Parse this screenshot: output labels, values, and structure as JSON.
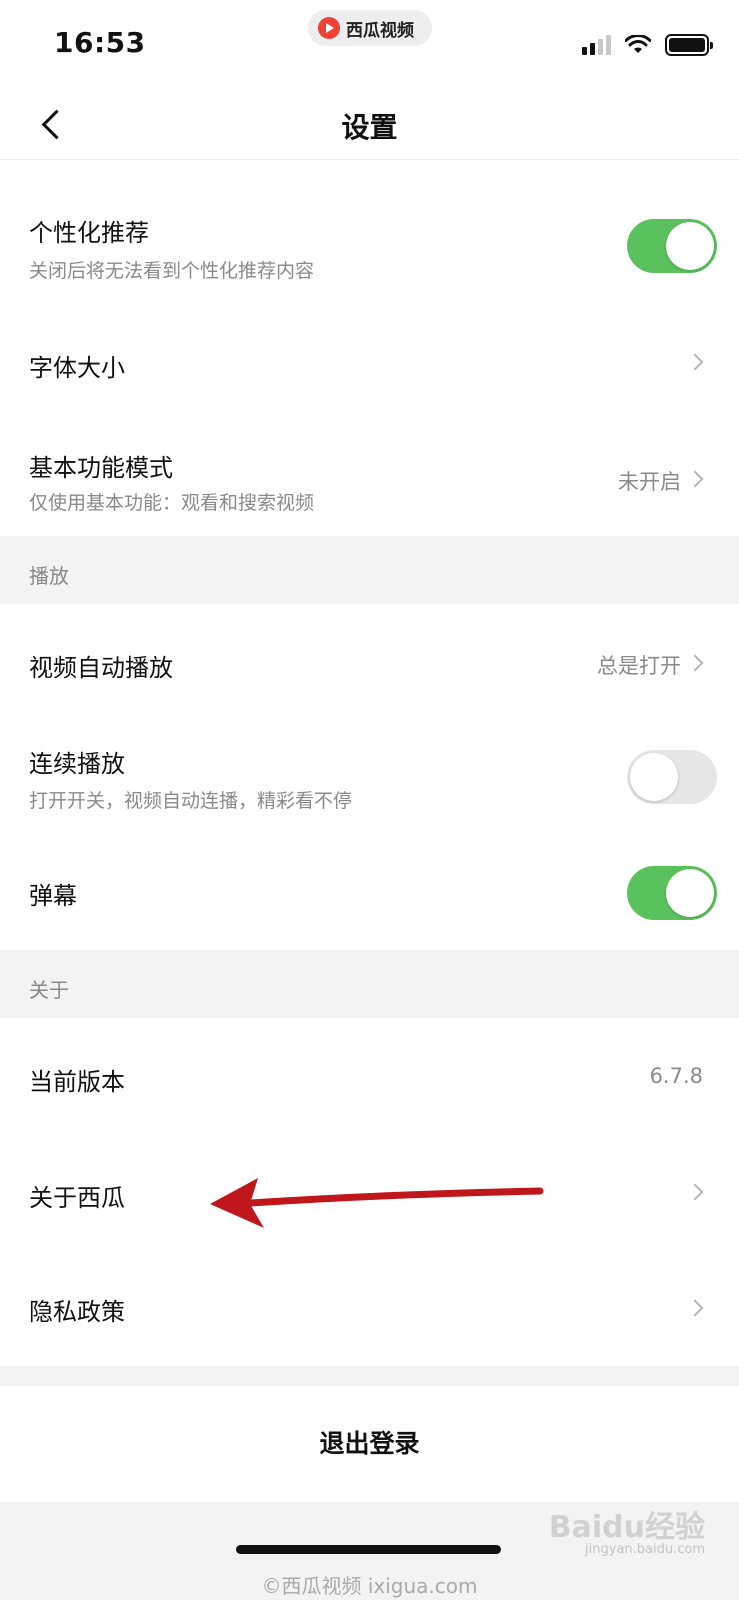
{
  "status_bar": {
    "time": "16:53",
    "app_name": "西瓜视频"
  },
  "nav": {
    "title": "设置"
  },
  "rows": {
    "personalized": {
      "label": "个性化推荐",
      "sub": "关闭后将无法看到个性化推荐内容",
      "toggle": true
    },
    "font_size": {
      "label": "字体大小"
    },
    "basic_mode": {
      "label": "基本功能模式",
      "sub": "仅使用基本功能：观看和搜索视频",
      "value": "未开启"
    },
    "autoplay": {
      "label": "视频自动播放",
      "value": "总是打开"
    },
    "continuous": {
      "label": "连续播放",
      "sub": "打开开关，视频自动连播，精彩看不停",
      "toggle": false
    },
    "danmaku": {
      "label": "弹幕",
      "toggle": true
    },
    "version": {
      "label": "当前版本",
      "value": "6.7.8"
    },
    "about": {
      "label": "关于西瓜"
    },
    "privacy": {
      "label": "隐私政策"
    }
  },
  "sections": {
    "playback": "播放",
    "about": "关于"
  },
  "logout": {
    "label": "退出登录"
  },
  "footer": {
    "text": "©西瓜视频 ixigua.com"
  },
  "watermark": {
    "text": "Baidu经验",
    "sub": "jingyan.baidu.com"
  },
  "colors": {
    "toggle_on": "#5ac25d",
    "toggle_off": "#e6e6e6",
    "arrow": "#c0171c"
  }
}
